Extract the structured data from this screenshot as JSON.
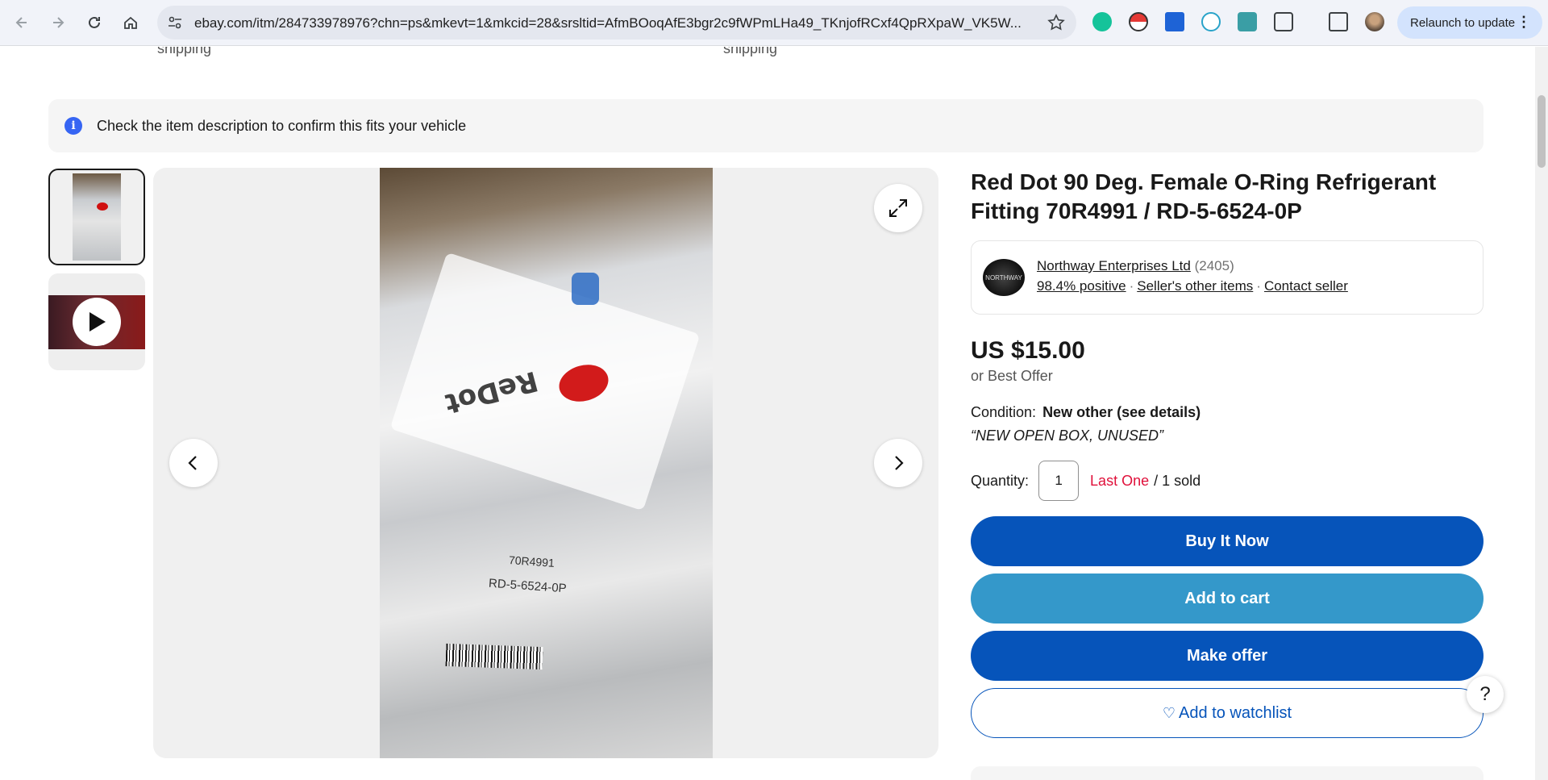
{
  "browser": {
    "url": "ebay.com/itm/284733978976?chn=ps&mkevt=1&mkcid=28&srsltid=AfmBOoqAfE3bgr2c9fWPmLHa49_TKnjofRCxf4QpRXpaW_VK5W...",
    "relaunch_label": "Relaunch to update"
  },
  "shipping": [
    "shipping",
    "shipping"
  ],
  "fit_banner": "Check the item description to confirm this fits your vehicle",
  "photo": {
    "brand_text": "ReDot",
    "part_number": "70R4991",
    "part_code": "RD-5-6524-0P"
  },
  "listing": {
    "title": "Red Dot 90 Deg. Female O-Ring Refrigerant Fitting 70R4991 / RD-5-6524-0P",
    "seller_name": "Northway Enterprises Ltd",
    "seller_count": "(2405)",
    "positive": "98.4% positive",
    "other_items": "Seller's other items",
    "contact": "Contact seller",
    "price": "US $15.00",
    "best_offer": "or Best Offer",
    "condition_label": "Condition:",
    "condition_value": "New other (see details)",
    "condition_note": "“NEW OPEN BOX, UNUSED”",
    "quantity_label": "Quantity:",
    "quantity_value": "1",
    "last_one": "Last One",
    "sold": "/ 1 sold",
    "buy_now": "Buy It Now",
    "add_to_cart": "Add to cart",
    "make_offer": "Make offer",
    "watchlist": "Add to watchlist"
  },
  "help": "?"
}
